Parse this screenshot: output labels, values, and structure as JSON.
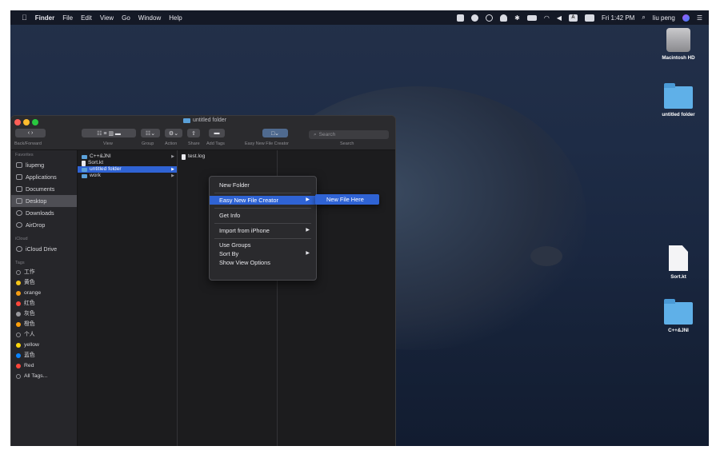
{
  "menubar": {
    "apple": "",
    "app": "Finder",
    "menus": [
      "File",
      "Edit",
      "View",
      "Go",
      "Window",
      "Help"
    ],
    "clock": "Fri 1:42 PM",
    "user": "liu peng",
    "icons": [
      "screen-icon",
      "wechat-icon",
      "time-machine-icon",
      "bell-icon",
      "bluetooth-icon",
      "battery-icon",
      "wifi-icon",
      "volume-icon",
      "input-a-icon",
      "ime-icon",
      "search-icon",
      "siri-icon",
      "list-icon"
    ],
    "input_badge": "A"
  },
  "window": {
    "title": "untitled folder",
    "back_forward_label": "Back/Forward",
    "toolbar_labels": [
      "View",
      "Group",
      "Action",
      "Share",
      "Add Tags",
      "Easy New File Creator",
      "Search"
    ],
    "search_placeholder": "Search"
  },
  "sidebar": {
    "favorites_header": "Favorites",
    "favorites": [
      {
        "label": "liupeng",
        "icon": "home-icon"
      },
      {
        "label": "Applications",
        "icon": "applications-icon"
      },
      {
        "label": "Documents",
        "icon": "documents-icon"
      },
      {
        "label": "Desktop",
        "icon": "desktop-icon"
      },
      {
        "label": "Downloads",
        "icon": "downloads-icon"
      },
      {
        "label": "AirDrop",
        "icon": "airdrop-icon"
      }
    ],
    "icloud_header": "iCloud",
    "icloud": [
      {
        "label": "iCloud Drive",
        "icon": "cloud-icon"
      }
    ],
    "tags_header": "Tags",
    "tags": [
      {
        "label": "工作",
        "color": "#2a2a2e"
      },
      {
        "label": "黄色",
        "color": "#f5c518"
      },
      {
        "label": "orange",
        "color": "#f39c12"
      },
      {
        "label": "红色",
        "color": "#ff453a"
      },
      {
        "label": "灰色",
        "color": "#98989d"
      },
      {
        "label": "橙色",
        "color": "#ff9f0a"
      },
      {
        "label": "个人",
        "color": "#2a2a2e"
      },
      {
        "label": "yellow",
        "color": "#ffd60a"
      },
      {
        "label": "蓝色",
        "color": "#0a84ff"
      },
      {
        "label": "Red",
        "color": "#ff453a"
      },
      {
        "label": "All Tags...",
        "color": "#2a2a2e"
      }
    ]
  },
  "columns": {
    "col1": [
      "C++&JNI",
      "Sort.kt",
      "untitled folder",
      "work"
    ],
    "col2": [
      "test.log"
    ]
  },
  "context_menu": {
    "items": [
      "New Folder",
      "Easy New File Creator",
      "Get Info",
      "Import from iPhone",
      "Use Groups",
      "Sort By",
      "Show View Options"
    ],
    "submenu_item": "New File Here"
  },
  "desktop_icons": [
    "Macintosh HD",
    "untitled folder",
    "Sort.kt",
    "C++&JNI"
  ]
}
